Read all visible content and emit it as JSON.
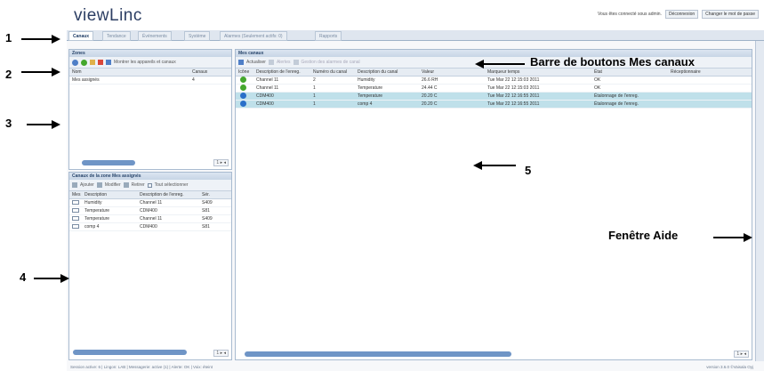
{
  "app": {
    "title": "viewLinc"
  },
  "topbar": {
    "welcome_text": "Vous êtes connecté sous admin.",
    "logout_button": "Déconnexion",
    "change_password_button": "Changer le mot de passe"
  },
  "tabs": [
    "Canaux",
    "Tendance",
    "Événements",
    "Système",
    "Alarmes (Seulement actifs: 0)",
    "Rapports"
  ],
  "zones_panel": {
    "title": "Zones",
    "toolbar_label": "Montrer les appareils et canaux",
    "columns": [
      "Nom",
      "Canaux"
    ],
    "rows": [
      {
        "name": "Mes assignés",
        "count": "4"
      }
    ]
  },
  "channels_zone_panel": {
    "title": "Canaux de la zone Mes assignés",
    "toolbar": [
      "Ajouter",
      "Modifier",
      "Retirer",
      "Tout sélectionner"
    ],
    "columns": [
      "Mes",
      "Description",
      "Description de l'enreg.",
      "Sér."
    ],
    "rows": [
      {
        "desc": "Humidity",
        "logger": "Channel 11",
        "ser": "S409"
      },
      {
        "desc": "Temperature",
        "logger": "CDM400",
        "ser": "S81"
      },
      {
        "desc": "Temperature",
        "logger": "Channel 11",
        "ser": "S409"
      },
      {
        "desc": "comp 4",
        "logger": "CDM400",
        "ser": "S81"
      }
    ]
  },
  "my_channels_panel": {
    "title": "Mes canaux",
    "toolbar": [
      "Actualiser",
      "Alertes",
      "Gestion des alarmes de canal"
    ],
    "columns": [
      "Icône",
      "Description de l'enreg.",
      "Numéro du canal",
      "Description du canal",
      "Valeur",
      "Marqueur temps",
      "État",
      "Réceptionnaire"
    ],
    "rows": [
      {
        "status_color": "#44a72d",
        "logger": "Channel 11",
        "num": "2",
        "desc": "Humidity",
        "value": "26.6 RH",
        "time": "Tue Mar 22 12:15:03 2011",
        "state": "OK",
        "sel": false
      },
      {
        "status_color": "#44a72d",
        "logger": "Channel 11",
        "num": "1",
        "desc": "Temperature",
        "value": "24.44 C",
        "time": "Tue Mar 22 12:15:03 2011",
        "state": "OK",
        "sel": false
      },
      {
        "status_color": "#2a6fc9",
        "logger": "CDM400",
        "num": "1",
        "desc": "Temperature",
        "value": "20.20 C",
        "time": "Tue Mar 22 12:16:55 2011",
        "state": "Étalonnage de l'enreg.",
        "sel": true
      },
      {
        "status_color": "#2a6fc9",
        "logger": "CDM400",
        "num": "1",
        "desc": "comp 4",
        "value": "20.20 C",
        "time": "Tue Mar 22 12:16:55 2011",
        "state": "Étalonnage de l'enreg.",
        "sel": true
      }
    ]
  },
  "pager": "1 ▸ ◂",
  "status_bar": "Session active: 6 | Lingon: LAB | Messagerie: active (1) | Alerte: OK | Voix: éteint",
  "version_text": "version 3.6.0 ©Vaisala Oyj",
  "callouts": {
    "c1": "1",
    "c2": "2",
    "c3": "3",
    "c4": "4",
    "c5": "5",
    "toolbar_callout": "Barre de boutons Mes canaux",
    "help_callout": "Fenêtre Aide"
  },
  "colors": {
    "ok": "#44a72d",
    "calibrating": "#2a6fc9",
    "selected_row": "#bfe0ea"
  }
}
